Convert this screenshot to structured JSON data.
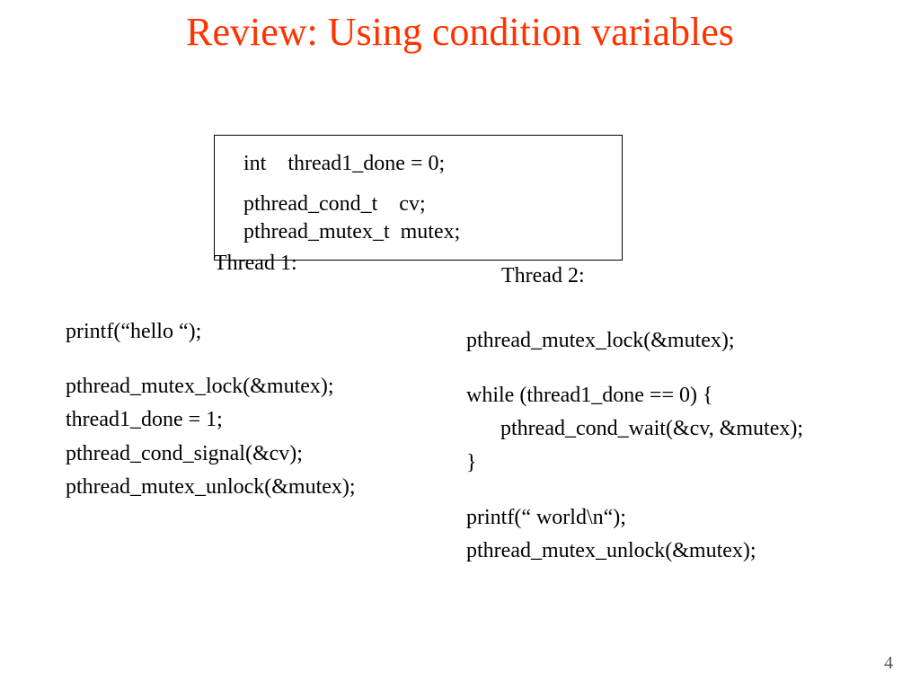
{
  "title": "Review: Using condition variables",
  "declarations": {
    "line1": "int    thread1_done = 0;",
    "line2": "pthread_cond_t    cv;",
    "line3": "pthread_mutex_t  mutex;"
  },
  "thread1": {
    "label": "Thread 1:",
    "lines": [
      "printf(“hello “);",
      "",
      "pthread_mutex_lock(&mutex);",
      "thread1_done = 1;",
      "pthread_cond_signal(&cv);",
      "pthread_mutex_unlock(&mutex);"
    ]
  },
  "thread2": {
    "label": "Thread 2:",
    "lines": [
      "pthread_mutex_lock(&mutex);",
      "",
      "while (thread1_done == 0) {",
      "pthread_cond_wait(&cv, &mutex);",
      "}",
      "",
      "printf(“ world\\n“);",
      "pthread_mutex_unlock(&mutex);"
    ]
  },
  "page_number": "4"
}
